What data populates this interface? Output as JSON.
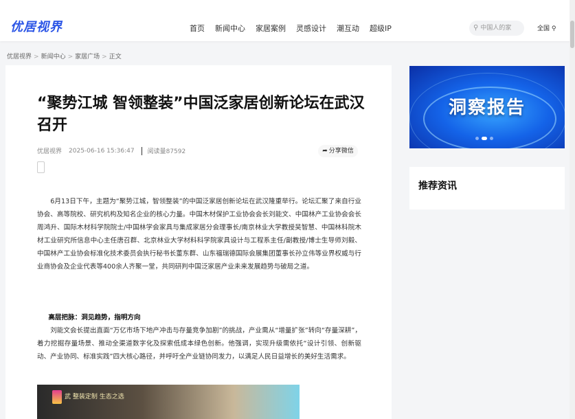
{
  "header": {
    "logo": "优居视界",
    "nav": [
      "首页",
      "新闻中心",
      "家居案例",
      "灵感设计",
      "潮互动",
      "超级IP"
    ],
    "search_placeholder": "中国人的家",
    "region": "全国"
  },
  "breadcrumb": [
    "优居视界",
    "新闻中心",
    "家居广场",
    "正文"
  ],
  "article": {
    "title": "“聚势江城 智领整装”中国泛家居创新论坛在武汉召开",
    "source": "优居视界",
    "date": "2025-06-16 15:36:47",
    "views": "阅读量87592",
    "share_label": "分享微信",
    "paragraph1": "6月13日下午，主题为“聚势江城，智领整装”的中国泛家居创新论坛在武汉隆重举行。论坛汇聚了来自行业协会、高等院校、研究机构及知名企业的核心力量。中国木材保护工业协会会长刘能文、中国林产工业协会会长周鸿升、国际木材科学院院士/中国林学会家具与集成家居分会理事长/南京林业大学教授吴智慧、中国林科院木材工业研究所信息中心主任唐召群、北京林业大学材料科学院家具设计与工程系主任/副教授/博士生导师刘毅、中国林产工业协会标准化技术委员会执行秘书长董东群、山东福瑞德国际会展集团董事长孙立伟等业界权威与行业商协会及企业代表等400余人齐聚一堂，共同研判中国泛家居产业未来发展趋势与破局之道。",
    "heading2": "高层把脉：洞见趋势，指明方向",
    "paragraph2": "刘能文会长提出直面“万亿市场下地产冲击与存量竞争加剧”的挑战，产业需从“增量扩张”转向“存量深耕”，着力挖掘存量场景、推动全渠道数字化及探索低成本绿色创新。他强调，实现升级需依托“设计引领、创新驱动、产业协同、标准实践”四大核心路径，并呼吁全产业链协同发力，以满足人民日益增长的美好生活需求。",
    "photo_caption": "武 整装定制 生态之选"
  },
  "sidebar": {
    "banner_title": "洞察报告",
    "recommend_title": "推荐资讯"
  },
  "colors": {
    "brand": "#2b55e6",
    "banner": "#1463e8"
  },
  "icons": {
    "search": "search-icon",
    "location": "location-pin-icon",
    "share": "share-arrow-icon"
  }
}
